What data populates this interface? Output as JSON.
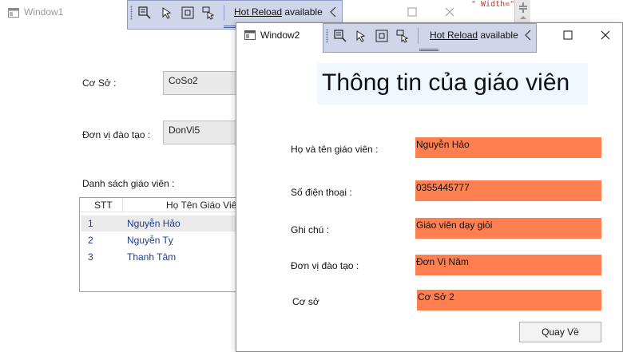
{
  "window1": {
    "title": "Window1",
    "co_so_label": "Cơ Sở :",
    "co_so_value": "CoSo2",
    "don_vi_label": "Đơn vị đào tạo :",
    "don_vi_value": "DonVi5",
    "list_label": "Danh sách giáo viên :",
    "columns": [
      "STT",
      "Họ Tên Giáo Viên"
    ],
    "rows": [
      {
        "stt": "1",
        "name": "Nguyễn Hảo",
        "selected": true
      },
      {
        "stt": "2",
        "name": "Nguyễn Tỵ",
        "selected": false
      },
      {
        "stt": "3",
        "name": "Thanh Tâm",
        "selected": false
      }
    ]
  },
  "ide": {
    "hot_reload_word": "Hot Reload",
    "hot_reload_rest": " available",
    "code_snippet": "\" Width=\"",
    "toolbar_color": "#cfd6ea"
  },
  "window2": {
    "title": "Window2",
    "heading": "Thông tin của giáo viên",
    "fields": [
      {
        "label": "Họ và tên giáo viên :",
        "value": "Nguyễn Hảo"
      },
      {
        "label": "Số điện thoại :",
        "value": "0355445777"
      },
      {
        "label": "Ghi chú :",
        "value": "Giáo viên dạy giỏi"
      },
      {
        "label": "Đơn vị đào tạo :",
        "value": "Đơn Vị Năm"
      },
      {
        "label": "Cơ sở",
        "value": "Cơ Sở 2"
      }
    ],
    "back_button": "Quay Về",
    "field_color": "#ff7f50",
    "heading_bg": "#f0f8ff"
  }
}
